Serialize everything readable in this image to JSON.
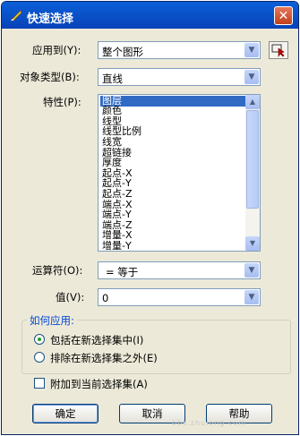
{
  "window": {
    "title": "快速选择",
    "close": "✕"
  },
  "fields": {
    "apply_to": {
      "label": "应用到(Y):",
      "value": "整个图形"
    },
    "object_type": {
      "label": "对象类型(B):",
      "value": "直线"
    },
    "properties": {
      "label": "特性(P):",
      "items": [
        "图层",
        "颜色",
        "线型",
        "线型比例",
        "线宽",
        "超链接",
        "厚度",
        "起点-X",
        "起点-Y",
        "起点-Z",
        "端点-X",
        "端点-Y",
        "端点-Z",
        "增量-X",
        "增量-Y"
      ],
      "selected": "图层"
    },
    "operator": {
      "label": "运算符(O):",
      "value": "= 等于"
    },
    "value": {
      "label": "值(V):",
      "value": "0"
    }
  },
  "apply_group": {
    "title": "如何应用:",
    "include": {
      "label": "包括在新选择集中(I)",
      "checked": true
    },
    "exclude": {
      "label": "排除在新选择集之外(E)",
      "checked": false
    }
  },
  "append": {
    "label": "附加到当前选择集(A)",
    "checked": false
  },
  "buttons": {
    "ok": "确定",
    "cancel": "取消",
    "help": "帮助"
  },
  "watermark": "bbs.zhulong.com",
  "icons": {
    "title": "app-icon",
    "pick": "select-objects-icon",
    "dropdown": "chevron-down-icon"
  }
}
